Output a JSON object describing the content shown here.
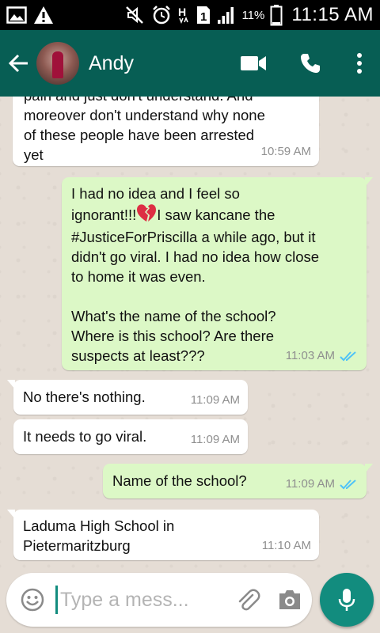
{
  "status_bar": {
    "icons": [
      "gallery-icon",
      "warning-icon",
      "mute-icon",
      "alarm-icon",
      "h-plus-icon",
      "sim-1-icon",
      "signal-icon",
      "battery-icon"
    ],
    "net_type": "H",
    "sim_slot": "1",
    "battery_percent": "11%",
    "time": "11:15 AM"
  },
  "header": {
    "contact_name": "Andy",
    "icons": [
      "back-arrow-icon",
      "video-call-icon",
      "phone-icon",
      "more-vertical-icon"
    ]
  },
  "messages": [
    {
      "direction": "in",
      "text": "pain and just don't understand. And\nmoreover don't understand why none\nof these people have been arrested\nyet",
      "time": "10:59 AM"
    },
    {
      "direction": "out",
      "text_before_emoji": "I had no idea and I feel so\nignorant!!!",
      "emoji": "broken-heart-icon",
      "text_after_emoji": "I saw kancane the\n#JusticeForPriscilla a while ago, but it\ndidn't go viral. I had no idea how close\nto home it was even.\n\nWhat's the name of the school?\nWhere is this school? Are there\nsuspects at least???",
      "time": "11:03 AM",
      "status": "read"
    },
    {
      "direction": "in",
      "text": "No there's nothing.",
      "time": "11:09 AM"
    },
    {
      "direction": "in",
      "text": "It needs to go viral.",
      "time": "11:09 AM"
    },
    {
      "direction": "out",
      "text": "Name of the school?",
      "time": "11:09 AM",
      "status": "read"
    },
    {
      "direction": "in",
      "text": "Laduma High School in\nPietermaritzburg",
      "time": "11:10 AM"
    }
  ],
  "composer": {
    "placeholder": "Type a mess...",
    "icons": [
      "emoji-icon",
      "attach-icon",
      "camera-icon",
      "microphone-icon"
    ]
  },
  "colors": {
    "header": "#075e54",
    "accent": "#128c7e",
    "incoming_bubble": "#ffffff",
    "outgoing_bubble": "#dcf8c6",
    "read_ticks": "#4fc3f7",
    "chat_background": "#e5ddd5"
  }
}
